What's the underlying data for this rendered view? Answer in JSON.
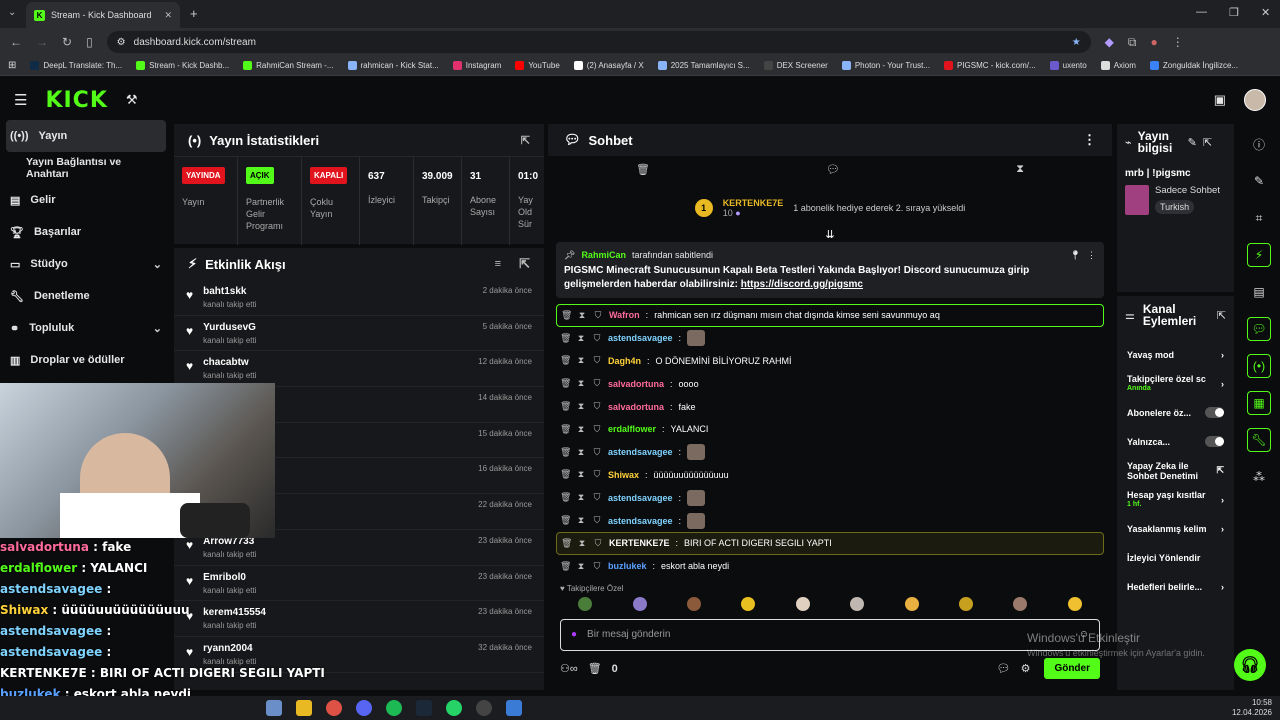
{
  "browser": {
    "tab_title": "Stream - Kick Dashboard",
    "url": "dashboard.kick.com/stream",
    "bookmarks": [
      "DeepL Translate: Th...",
      "Stream - Kick Dashb...",
      "RahmiCan Stream -...",
      "rahmican - Kick Stat...",
      "Instagram",
      "YouTube",
      "(2) Anasayfa / X",
      "2025 Tamamlayıcı S...",
      "DEX Screener",
      "Photon - Your Trust...",
      "PIGSMC - kick.com/...",
      "uxento",
      "Axiom",
      "Zonguldak İngilizce..."
    ]
  },
  "sidebar": {
    "items": [
      {
        "label": "Yayın",
        "icon": "broadcast-icon"
      },
      {
        "label": "Yayın Bağlantısı ve Anahtarı",
        "icon": ""
      },
      {
        "label": "Gelir",
        "icon": "money-icon"
      },
      {
        "label": "Başarılar",
        "icon": "trophy-icon"
      },
      {
        "label": "Stüdyo",
        "icon": "studio-icon"
      },
      {
        "label": "Denetleme",
        "icon": "wrench-icon"
      },
      {
        "label": "Topluluk",
        "icon": "community-icon"
      },
      {
        "label": "Droplar ve ödüller",
        "icon": "gift-icon"
      }
    ]
  },
  "stats": {
    "title": "Yayın İstatistikleri",
    "cells": [
      {
        "badge": "YAYINDA",
        "badge_color": "#e1141d",
        "badge_text_color": "#ffffff",
        "label": "Yayın"
      },
      {
        "badge": "AÇIK",
        "badge_color": "#53fc18",
        "badge_text_color": "#000000",
        "label": "Partnerlik Gelir Programı"
      },
      {
        "badge": "KAPALI",
        "badge_color": "#e1141d",
        "badge_text_color": "#ffffff",
        "label": "Çoklu Yayın"
      },
      {
        "value": "637",
        "label": "İzleyici"
      },
      {
        "value": "39.009",
        "label": "Takipçi"
      },
      {
        "value": "31",
        "label": "Abone Sayısı"
      },
      {
        "value": "01:0",
        "label": "Yay Old Sür"
      }
    ]
  },
  "activity": {
    "title": "Etkinlik Akışı",
    "items": [
      {
        "name": "baht1skk",
        "sub": "kanalı takip etti",
        "time": "2 dakika önce"
      },
      {
        "name": "YurdusevG",
        "sub": "kanalı takip etti",
        "time": "5 dakika önce"
      },
      {
        "name": "chacabtw",
        "sub": "kanalı takip etti",
        "time": "12 dakika önce"
      },
      {
        "name": "",
        "sub": "",
        "time": "14 dakika önce"
      },
      {
        "name": "",
        "sub": "",
        "time": "15 dakika önce"
      },
      {
        "name": "",
        "sub": "",
        "time": "16 dakika önce"
      },
      {
        "name": "",
        "sub": "",
        "time": "22 dakika önce"
      },
      {
        "name": "Arrow7733",
        "sub": "kanalı takip etti",
        "time": "23 dakika önce"
      },
      {
        "name": "Emribol0",
        "sub": "kanalı takip etti",
        "time": "23 dakika önce"
      },
      {
        "name": "kerem415554",
        "sub": "kanalı takip etti",
        "time": "23 dakika önce"
      },
      {
        "name": "ryann2004",
        "sub": "kanalı takip etti",
        "time": "32 dakika önce"
      }
    ]
  },
  "overlay_chat": [
    {
      "user": "salvadortuna",
      "text": " : fake",
      "color": "#ff6b9a"
    },
    {
      "user": "erdalflower",
      "text": " : YALANCI",
      "color": "#53fc18"
    },
    {
      "user": "astendsavagee",
      "text": " : ",
      "color": "#7fd3ff"
    },
    {
      "user": "Shiwax",
      "text": " : üüüüuuüüüüüüuuu",
      "color": "#ffd23a"
    },
    {
      "user": "astendsavagee",
      "text": " : ",
      "color": "#7fd3ff"
    },
    {
      "user": "astendsavagee",
      "text": " : ",
      "color": "#7fd3ff"
    },
    {
      "user": "KERTENKE7E",
      "text": " : BIRI OF ACTI DIGERI SEGILI YAPTI",
      "color": "#ffffff"
    },
    {
      "user": "buzlukek",
      "text": " : eskort abla neydi",
      "color": "#5aa0ff"
    }
  ],
  "chat": {
    "title": "Sohbet",
    "gift_user": "KERTENKE7E",
    "gift_count": "10",
    "gift_text": "1 abonelik hediye ederek 2. sıraya yükseldi",
    "pinned_by": "RahmiCan",
    "pinned_by_suffix": "tarafından sabitlendi",
    "pinned_text": "PIGSMC Minecraft Sunucusunun Kapalı Beta Testleri Yakında Başlıyor! Discord sunucumuza girip gelişmelerden haberdar olabilirsiniz:",
    "pinned_link": "https://discord.gg/pigsmc",
    "messages": [
      {
        "user": "Wafron",
        "text": "rahmican sen ırz düşmanı mısın chat dışında kimse seni savunmuyo aq",
        "color": "#ff6b9a",
        "style": "hl"
      },
      {
        "user": "astendsavagee",
        "text": "",
        "color": "#7fd3ff",
        "style": "",
        "emote": true
      },
      {
        "user": "Dagh4n",
        "text": "O DÖNEMİNİ BİLİYORUZ RAHMİ",
        "color": "#ffd23a",
        "style": ""
      },
      {
        "user": "salvadortuna",
        "text": "oooo",
        "color": "#ff6b9a",
        "style": ""
      },
      {
        "user": "salvadortuna",
        "text": "fake",
        "color": "#ff6b9a",
        "style": ""
      },
      {
        "user": "erdalflower",
        "text": "YALANCI",
        "color": "#53fc18",
        "style": ""
      },
      {
        "user": "astendsavagee",
        "text": "",
        "color": "#7fd3ff",
        "style": "",
        "emote": true
      },
      {
        "user": "Shiwax",
        "text": "üüüüuuüüüüüüuuu",
        "color": "#ffd23a",
        "style": ""
      },
      {
        "user": "astendsavagee",
        "text": "",
        "color": "#7fd3ff",
        "style": "",
        "emote": true
      },
      {
        "user": "astendsavagee",
        "text": "",
        "color": "#7fd3ff",
        "style": "",
        "emote": true
      },
      {
        "user": "KERTENKE7E",
        "text": "BIRI OF ACTI DIGERI SEGILI YAPTI",
        "color": "#ffffff",
        "style": "hl2"
      },
      {
        "user": "buzlukek",
        "text": "eskort abla neydi",
        "color": "#5aa0ff",
        "style": ""
      }
    ],
    "emote_section": "Takipçilere Özel",
    "input_placeholder": "Bir mesaj gönderin",
    "footer_count": "0",
    "send_label": "Gönder"
  },
  "stream_info": {
    "title": "Yayın bilgisi",
    "stream_title": "mrb | !pigsmc",
    "category": "Sadece Sohbet",
    "language": "Turkish"
  },
  "channel_actions": {
    "title": "Kanal Eylemleri",
    "items": [
      {
        "label": "Yavaş mod",
        "sub": "",
        "control": "chevron"
      },
      {
        "label": "Takipçilere özel sc",
        "sub": "Anında",
        "control": "chevron"
      },
      {
        "label": "Abonelere öz...",
        "sub": "",
        "control": "toggle"
      },
      {
        "label": "Yalnızca...",
        "sub": "",
        "control": "toggle"
      },
      {
        "label": "Yapay Zeka ile Sohbet Denetimi",
        "sub": "",
        "control": "link"
      },
      {
        "label": "Hesap yaşı kısıtlar",
        "sub": "1 hf.",
        "control": "chevron"
      },
      {
        "label": "Yasaklanmış kelim",
        "sub": "",
        "control": "chevron"
      },
      {
        "label": "İzleyici Yönlendir",
        "sub": "",
        "control": ""
      },
      {
        "label": "Hedefleri belirle...",
        "sub": "",
        "control": "chevron"
      }
    ]
  },
  "windows": {
    "watermark_title": "Windows'u Etkinleştir",
    "watermark_sub": "Windows'u etkinleştirmek için Ayarlar'a gidin.",
    "time": "10:58",
    "date": "12.04.2026"
  },
  "colors": {
    "accent": "#53fc18",
    "live": "#e1141d",
    "panel": "#17181b",
    "bg": "#0b0c0e"
  }
}
